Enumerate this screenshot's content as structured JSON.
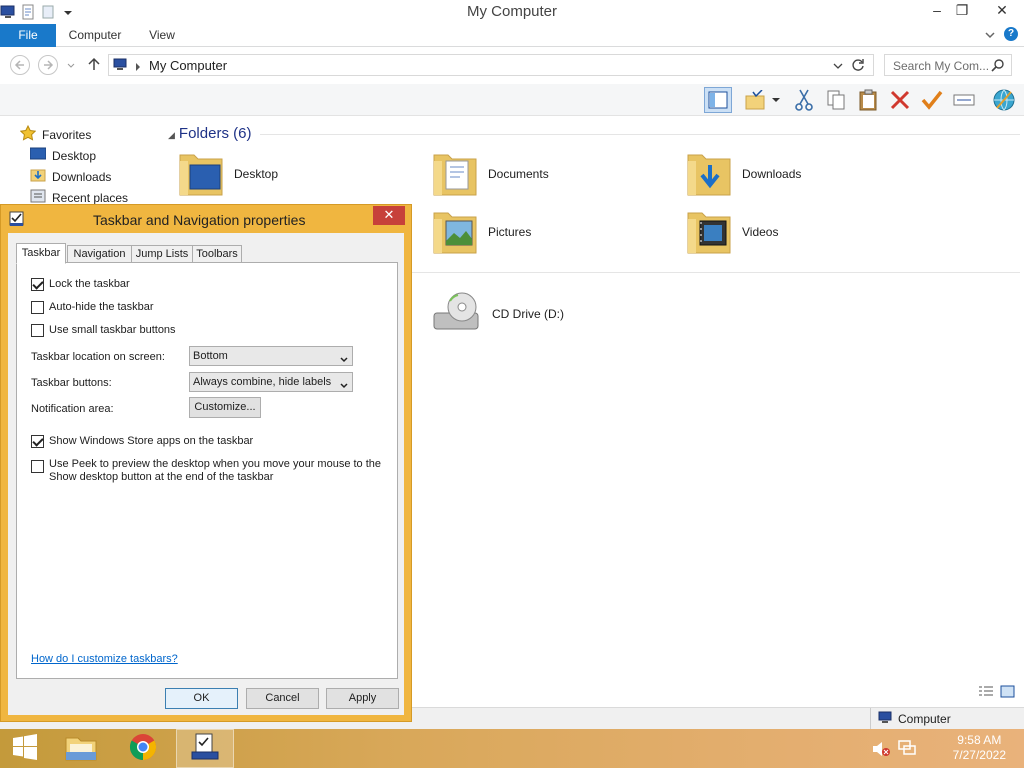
{
  "window": {
    "title": "My Computer",
    "minimize": "–",
    "restore": "❐",
    "close": "✕"
  },
  "ribbon": {
    "tabs": [
      "File",
      "Computer",
      "View"
    ]
  },
  "address": {
    "path": "My Computer",
    "search_placeholder": "Search My Com..."
  },
  "nav": {
    "favorites": "Favorites",
    "items": [
      "Desktop",
      "Downloads",
      "Recent places"
    ]
  },
  "content": {
    "group_title": "Folders (6)",
    "folders": [
      "Desktop",
      "Documents",
      "Downloads",
      "Pictures",
      "Videos"
    ],
    "drive": "CD Drive (D:)"
  },
  "status": {
    "location": "Computer"
  },
  "dialog": {
    "title": "Taskbar and Navigation properties",
    "close": "✕",
    "tabs": [
      "Taskbar",
      "Navigation",
      "Jump Lists",
      "Toolbars"
    ],
    "lock_taskbar": "Lock the taskbar",
    "autohide": "Auto-hide the taskbar",
    "small_buttons": "Use small taskbar buttons",
    "location_label": "Taskbar location on screen:",
    "location_value": "Bottom",
    "buttons_label": "Taskbar buttons:",
    "buttons_value": "Always combine, hide labels",
    "notification_label": "Notification area:",
    "customize": "Customize...",
    "store_apps": "Show Windows Store apps on the taskbar",
    "peek": "Use Peek to preview the desktop when you move your mouse to the Show desktop button at the end of the taskbar",
    "help_link": "How do I customize taskbars?",
    "ok": "OK",
    "cancel": "Cancel",
    "apply": "Apply"
  },
  "taskbar": {
    "time": "9:58 AM",
    "date": "7/27/2022"
  },
  "colors": {
    "accent": "#1979ca",
    "dialog_frame": "#f0b640",
    "taskbar": "#d9a85a",
    "close": "#c7413a"
  }
}
